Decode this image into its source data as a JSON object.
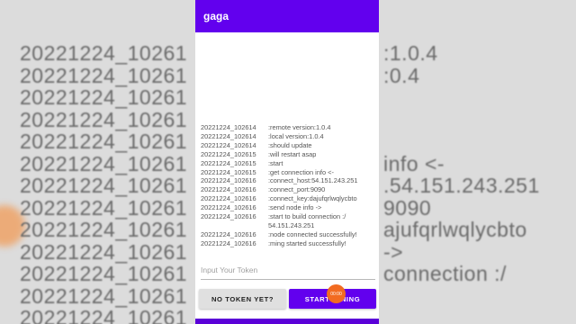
{
  "app": {
    "title": "gaga"
  },
  "log": [
    {
      "time": "20221224_102614",
      "message": ":remote version:1.0.4"
    },
    {
      "time": "20221224_102614",
      "message": ":local version:1.0.4"
    },
    {
      "time": "20221224_102614",
      "message": ":should update"
    },
    {
      "time": "20221224_102615",
      "message": ":will restart asap"
    },
    {
      "time": "20221224_102615",
      "message": ":start"
    },
    {
      "time": "20221224_102615",
      "message": ":get connection info <-"
    },
    {
      "time": "20221224_102616",
      "message": ":connect_host:54.151.243.251"
    },
    {
      "time": "20221224_102616",
      "message": ":connect_port:9090"
    },
    {
      "time": "20221224_102616",
      "message": ":connect_key:dajufqrlwqlycbto"
    },
    {
      "time": "20221224_102616",
      "message": ":send node info ->"
    },
    {
      "time": "20221224_102616",
      "message": ":start to build connection :/ 54.151.243.251"
    },
    {
      "time": "20221224_102616",
      "message": ":node connected successfully!"
    },
    {
      "time": "20221224_102616",
      "message": ":ming started successfully!"
    }
  ],
  "token_input": {
    "placeholder": "Input Your Token",
    "value": ""
  },
  "buttons": {
    "no_token": "NO TOKEN YET?",
    "start": "START MINING"
  },
  "touch_indicator": {
    "label": "00:00"
  },
  "backdrop": [
    "20221224_10261",
    "20221224_10261",
    "20221224_10261",
    "20221224_10261",
    "20221224_10261",
    "20221224_10261",
    "20221224_10261",
    "20221224_10261",
    "20221224_10261",
    "20221224_10261",
    "20221224_10261",
    "20221224_10261",
    "20221224_10261"
  ],
  "backdrop_right": [
    ":1.0.4",
    ":0.4",
    "",
    "",
    "",
    "info <-",
    ".54.151.243.251",
    "9090",
    "ajufqrlwqlycbto",
    "->",
    "connection :/",
    "",
    ""
  ],
  "colors": {
    "primary": "#6200ee",
    "accent": "#f26b21"
  }
}
